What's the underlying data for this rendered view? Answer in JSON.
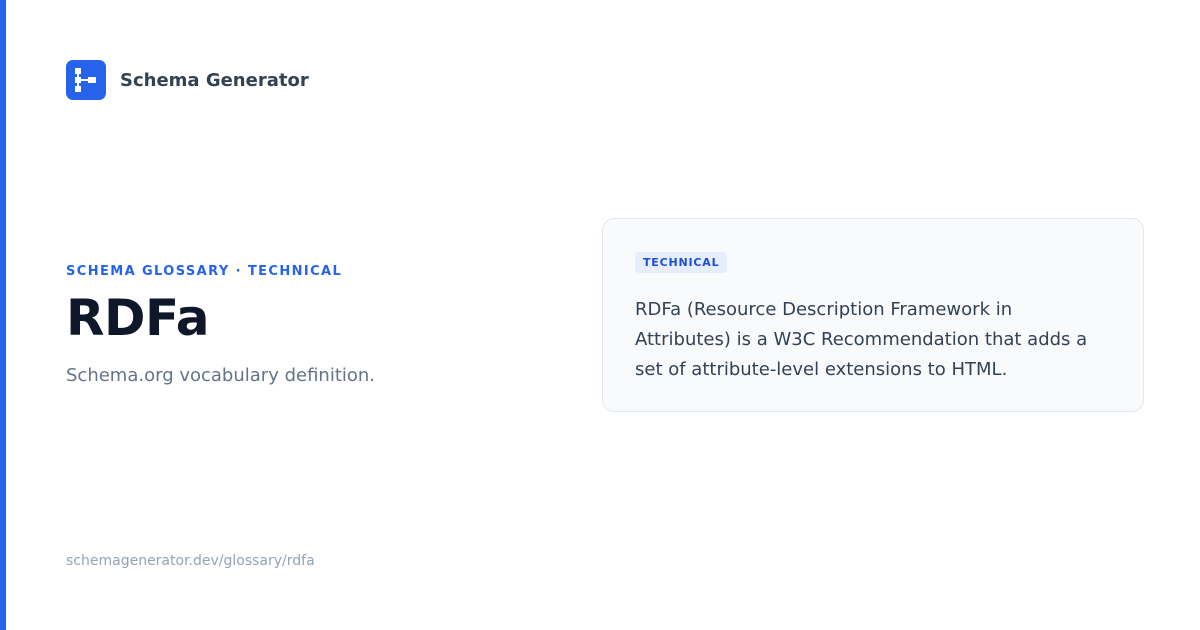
{
  "brand": {
    "name": "Schema Generator",
    "logo_icon": "sitemap-icon",
    "accent_color": "#2563eb"
  },
  "hero": {
    "eyebrow": "SCHEMA GLOSSARY · TECHNICAL",
    "title": "RDFa",
    "subtitle": "Schema.org vocabulary definition."
  },
  "definition_card": {
    "badge": "TECHNICAL",
    "text": "RDFa (Resource Description Framework in Attributes) is a W3C Recommendation that adds a set of attribute-level extensions to HTML."
  },
  "footer": {
    "url": "schemagenerator.dev/glossary/rdfa"
  }
}
